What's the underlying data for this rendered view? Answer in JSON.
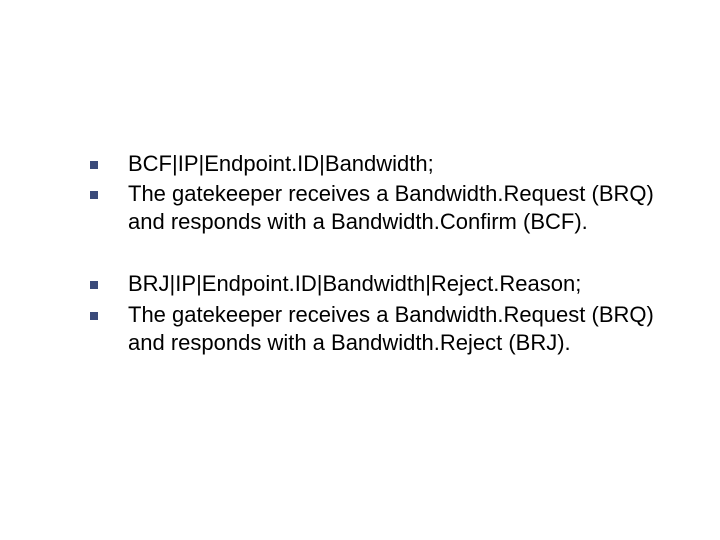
{
  "blocks": [
    {
      "items": [
        "BCF|IP|Endpoint.ID|Bandwidth;",
        "The gatekeeper receives a Bandwidth.Request (BRQ) and responds with a Bandwidth.Confirm (BCF)."
      ]
    },
    {
      "items": [
        "BRJ|IP|Endpoint.ID|Bandwidth|Reject.Reason;",
        "The gatekeeper receives a Bandwidth.Request (BRQ) and responds with a Bandwidth.Reject (BRJ)."
      ]
    }
  ]
}
